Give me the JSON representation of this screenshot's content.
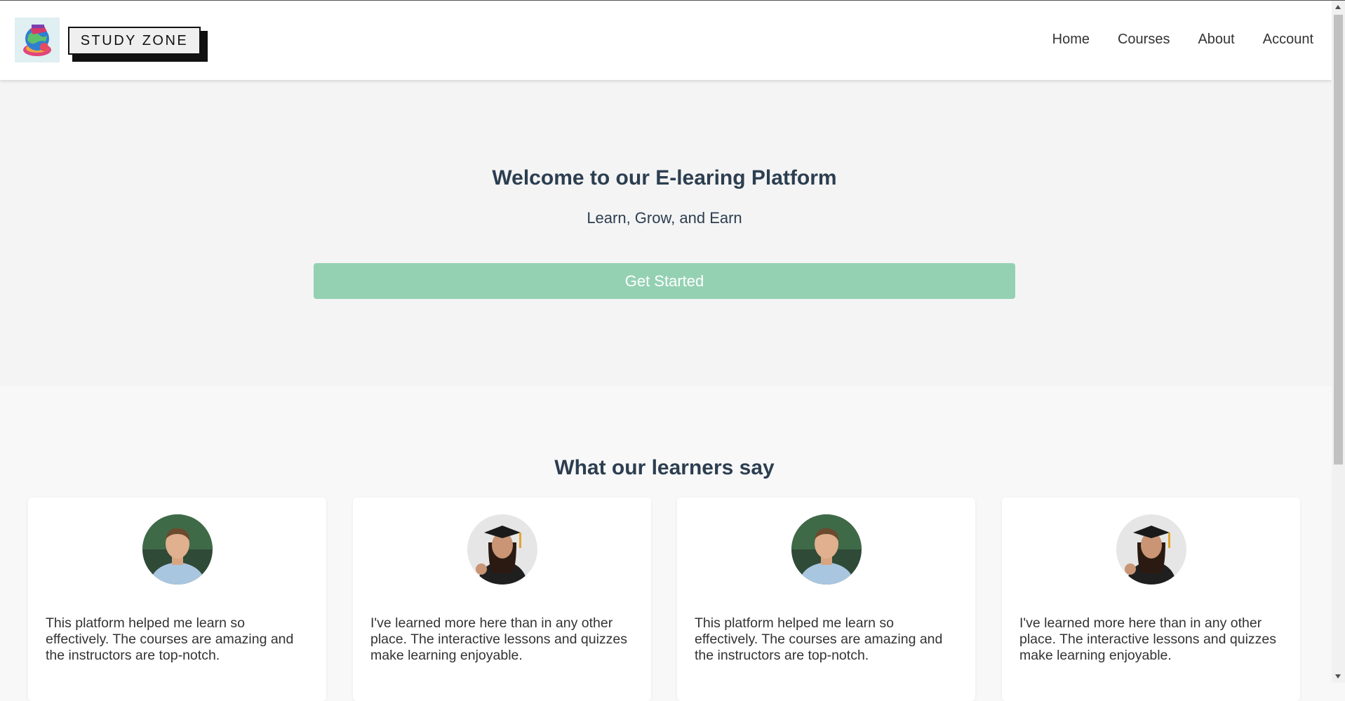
{
  "header": {
    "logo_text": "STUDY ZONE",
    "logo_icon": "study-globe-logo",
    "nav": [
      {
        "label": "Home"
      },
      {
        "label": "Courses"
      },
      {
        "label": "About"
      },
      {
        "label": "Account"
      }
    ]
  },
  "hero": {
    "title": "Welcome to our E-learing Platform",
    "subtitle": "Learn, Grow, and Earn",
    "cta_label": "Get Started",
    "cta_color": "#94d1b3"
  },
  "testimonials": {
    "heading": "What our learners say",
    "cards": [
      {
        "avatar": "man-avatar",
        "quote": "This platform helped me learn so effectively. The courses are amazing and the instructors are top-notch."
      },
      {
        "avatar": "graduate-woman-avatar",
        "quote": "I've learned more here than in any other place. The interactive lessons and quizzes make learning enjoyable."
      },
      {
        "avatar": "man-avatar",
        "quote": "This platform helped me learn so effectively. The courses are amazing and the instructors are top-notch."
      },
      {
        "avatar": "graduate-woman-avatar",
        "quote": "I've learned more here than in any other place. The interactive lessons and quizzes make learning enjoyable."
      }
    ]
  },
  "colors": {
    "heading": "#2c3e50",
    "hero_bg": "#f4f4f4",
    "page_bg": "#f8f8f8"
  }
}
